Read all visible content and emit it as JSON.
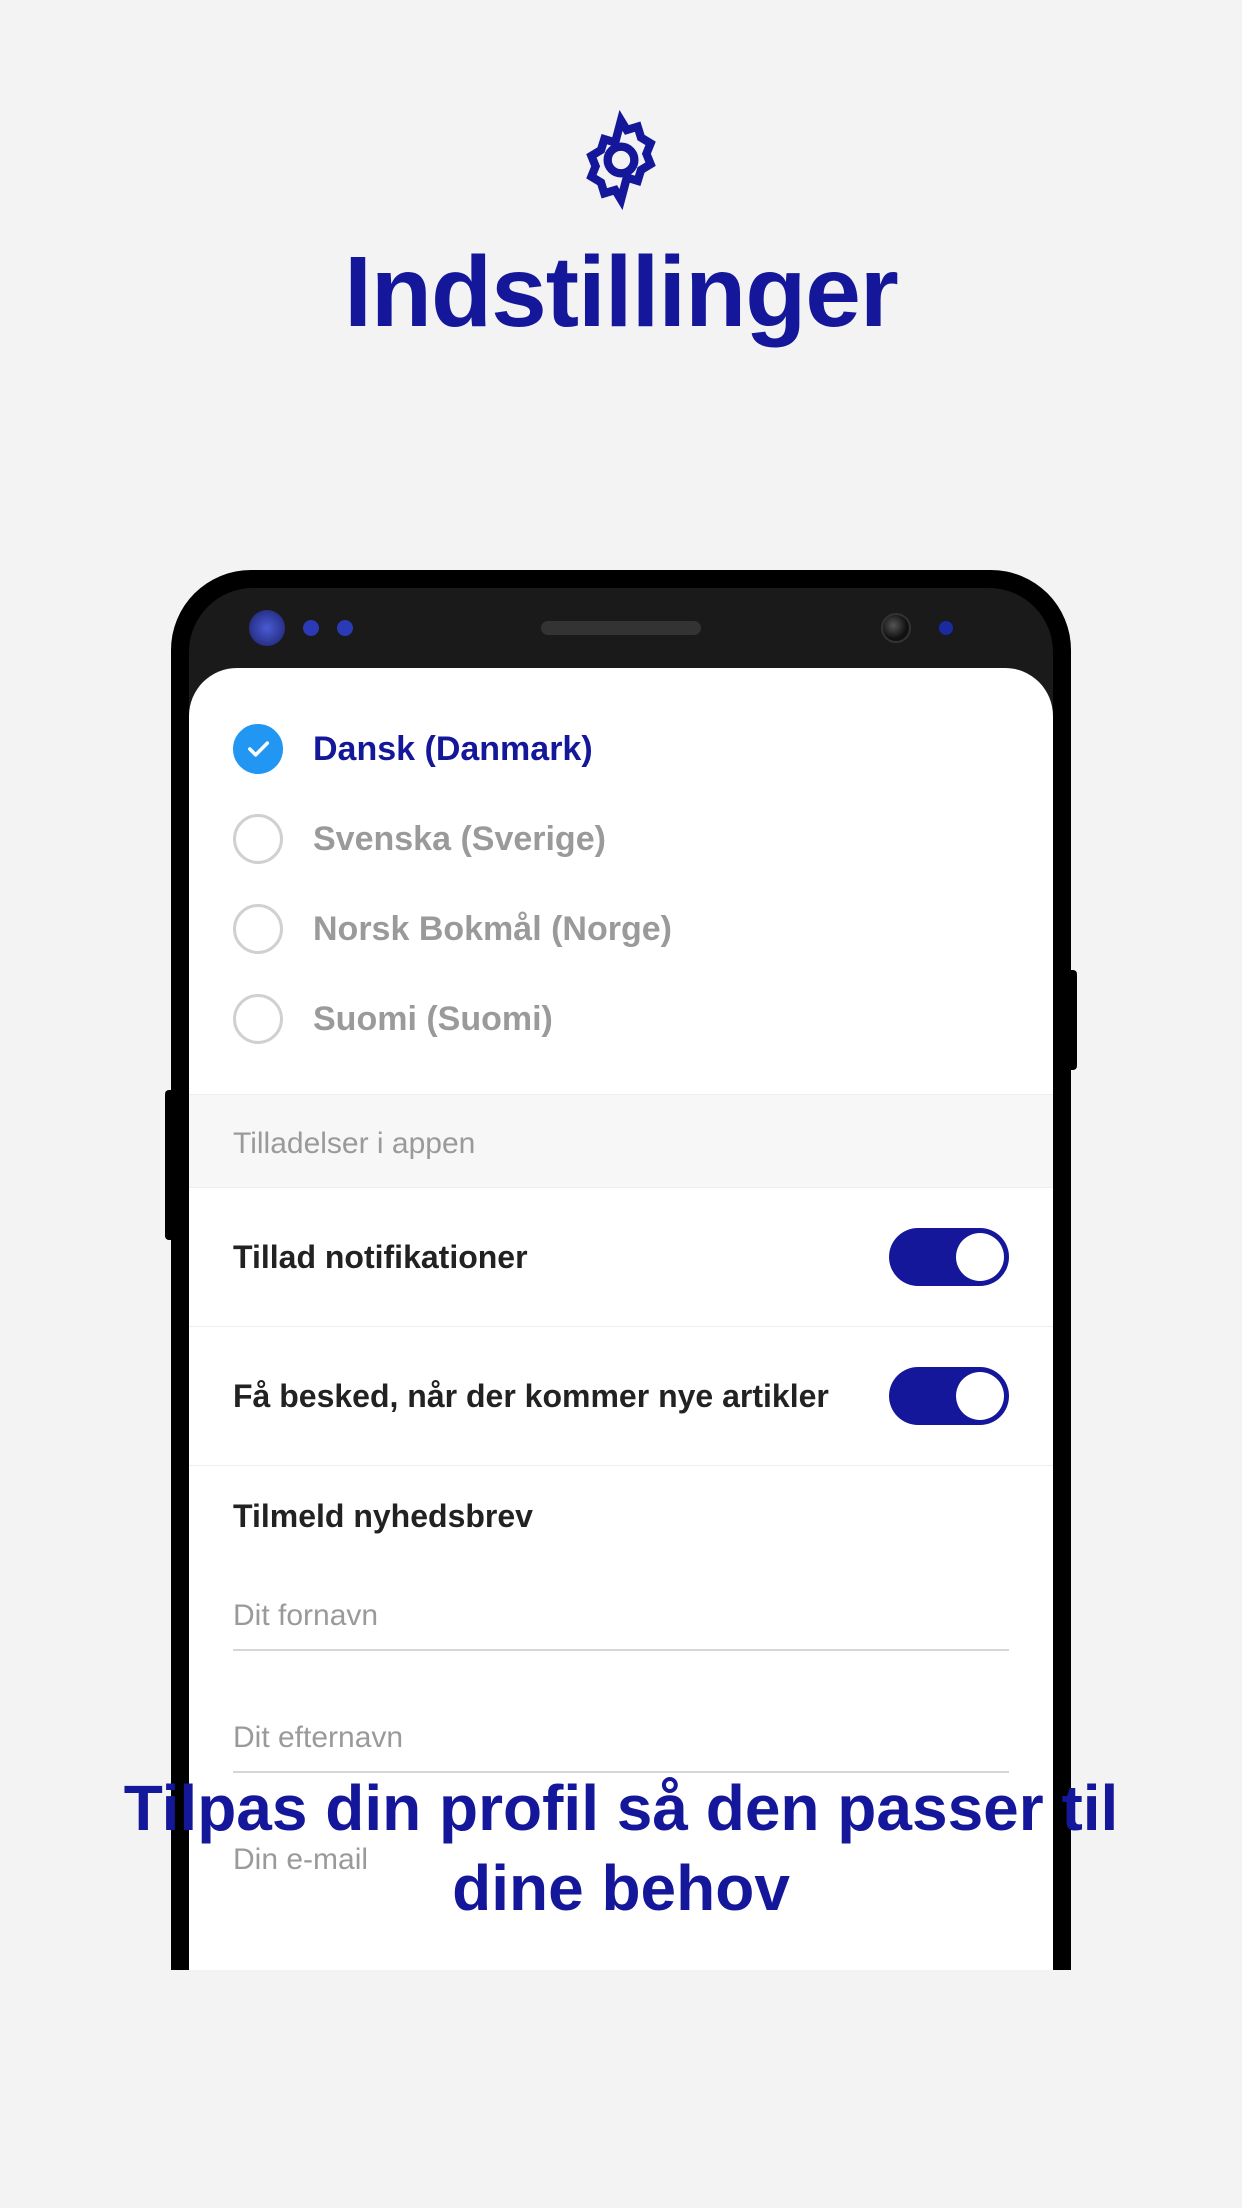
{
  "header": {
    "title": "Indstillinger",
    "icon": "gear-icon"
  },
  "languages": [
    {
      "label": "Dansk (Danmark)",
      "selected": true
    },
    {
      "label": "Svenska (Sverige)",
      "selected": false
    },
    {
      "label": "Norsk Bokmål (Norge)",
      "selected": false
    },
    {
      "label": "Suomi (Suomi)",
      "selected": false
    }
  ],
  "permissions": {
    "section_title": "Tilladelser i appen",
    "toggles": [
      {
        "label": "Tillad notifikationer",
        "on": true
      },
      {
        "label": "Få besked, når der kommer nye artikler",
        "on": true
      }
    ]
  },
  "newsletter": {
    "title": "Tilmeld nyhedsbrev",
    "fields": [
      {
        "placeholder": "Dit fornavn"
      },
      {
        "placeholder": "Dit efternavn"
      },
      {
        "placeholder": "Din e-mail"
      }
    ]
  },
  "footer": {
    "text": "Tilpas din profil så den passer til dine behov"
  },
  "colors": {
    "brand": "#15179a",
    "accent": "#2196f3"
  }
}
